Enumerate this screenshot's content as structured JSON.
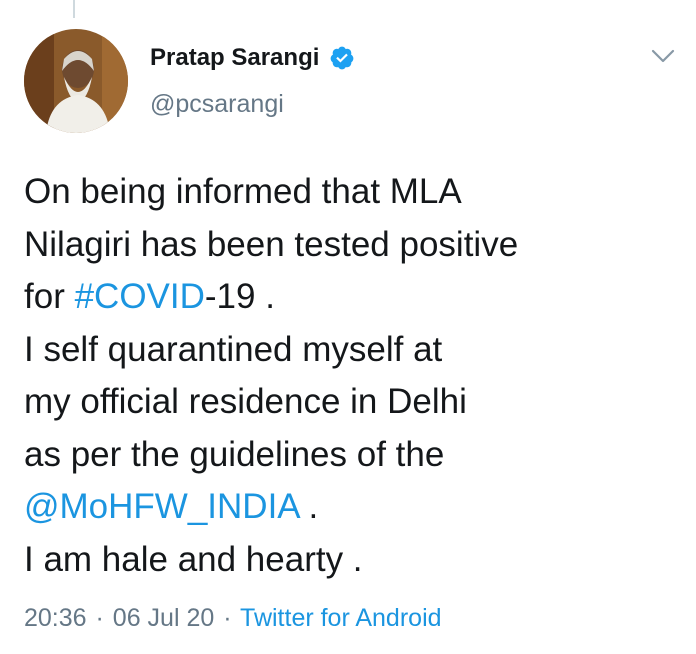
{
  "author": {
    "name": "Pratap Sarangi",
    "handle": "@pcsarangi",
    "verified": true,
    "avatar_icon": "profile-photo"
  },
  "tweet": {
    "line1": "On being informed that MLA",
    "line2": "Nilagiri has been tested positive",
    "line3_prefix": "for ",
    "hashtag": "#COVID",
    "line3_suffix": "-19 .",
    "line4": "I self quarantined myself at",
    "line5": "my official residence in Delhi",
    "line6": "as per the guidelines of the",
    "mention": "@MoHFW_INDIA",
    "line7_suffix": " .",
    "line8": "I am hale and hearty ."
  },
  "meta": {
    "time": "20:36",
    "separator": "·",
    "date": "06 Jul 20",
    "source": "Twitter for Android"
  },
  "colors": {
    "link": "#1b95e0",
    "secondary_text": "#657786",
    "primary_text": "#14171a",
    "verified_badge": "#1da1f2"
  },
  "icons": {
    "caret": "chevron-down-icon",
    "verified": "verified-badge-icon"
  }
}
